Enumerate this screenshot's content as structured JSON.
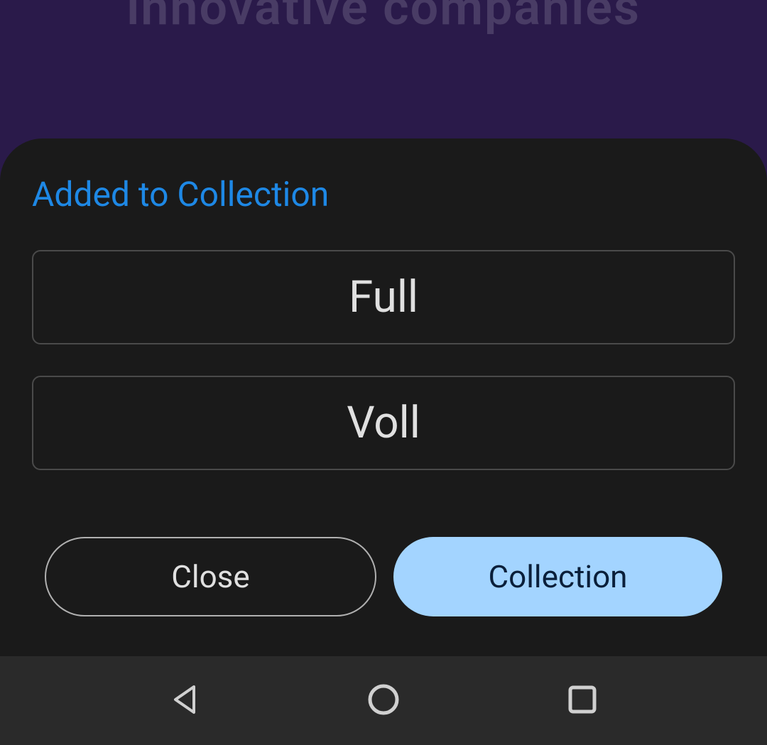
{
  "background": {
    "partial_text": "innovative companies"
  },
  "sheet": {
    "title": "Added to Collection",
    "options": [
      {
        "label": "Full"
      },
      {
        "label": "Voll"
      }
    ],
    "actions": {
      "close_label": "Close",
      "collection_label": "Collection"
    }
  },
  "navbar": {
    "back_icon": "back-icon",
    "home_icon": "home-icon",
    "recent_icon": "recent-icon"
  }
}
